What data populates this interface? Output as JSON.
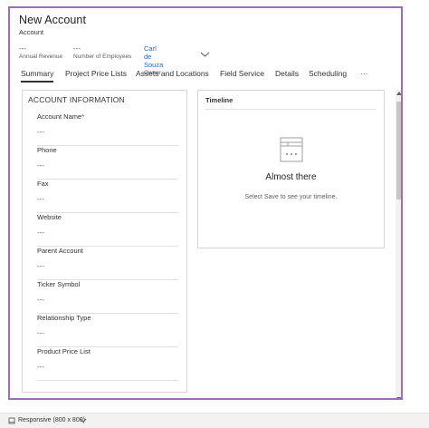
{
  "header": {
    "title": "New Account",
    "subtitle": "Account",
    "fields": [
      {
        "value": "---",
        "label": "Annual Revenue"
      },
      {
        "value": "---",
        "label": "Number of Employees"
      },
      {
        "value": "Carl de Souza",
        "label": "Owner"
      }
    ],
    "expand_icon": "chevron-down-icon"
  },
  "tabs": [
    {
      "label": "Summary",
      "active": true
    },
    {
      "label": "Project Price Lists",
      "active": false
    },
    {
      "label": "Assets and Locations",
      "active": false
    },
    {
      "label": "Field Service",
      "active": false
    },
    {
      "label": "Details",
      "active": false
    },
    {
      "label": "Scheduling",
      "active": false
    },
    {
      "label": "···",
      "active": false
    }
  ],
  "account_info": {
    "title": "ACCOUNT INFORMATION",
    "fields": [
      {
        "label": "Account Name",
        "required": "*",
        "value": "---"
      },
      {
        "label": "Phone",
        "value": "---"
      },
      {
        "label": "Fax",
        "value": "---"
      },
      {
        "label": "Website",
        "value": "---"
      },
      {
        "label": "Parent Account",
        "value": "---"
      },
      {
        "label": "Ticker Symbol",
        "value": "---"
      },
      {
        "label": "Relationship Type",
        "value": "---"
      },
      {
        "label": "Product Price List",
        "value": "---"
      }
    ]
  },
  "timeline": {
    "title": "Timeline",
    "heading": "Almost there",
    "message": "Select Save to see your timeline.",
    "icon": "timeline-empty-icon"
  },
  "bottom_bar": {
    "label": "Responsive (800 x 800)",
    "icon": "device-icon"
  },
  "colors": {
    "frame_border": "#9b6fb3",
    "owner_link": "#2266c8",
    "required": "#a4262c"
  }
}
